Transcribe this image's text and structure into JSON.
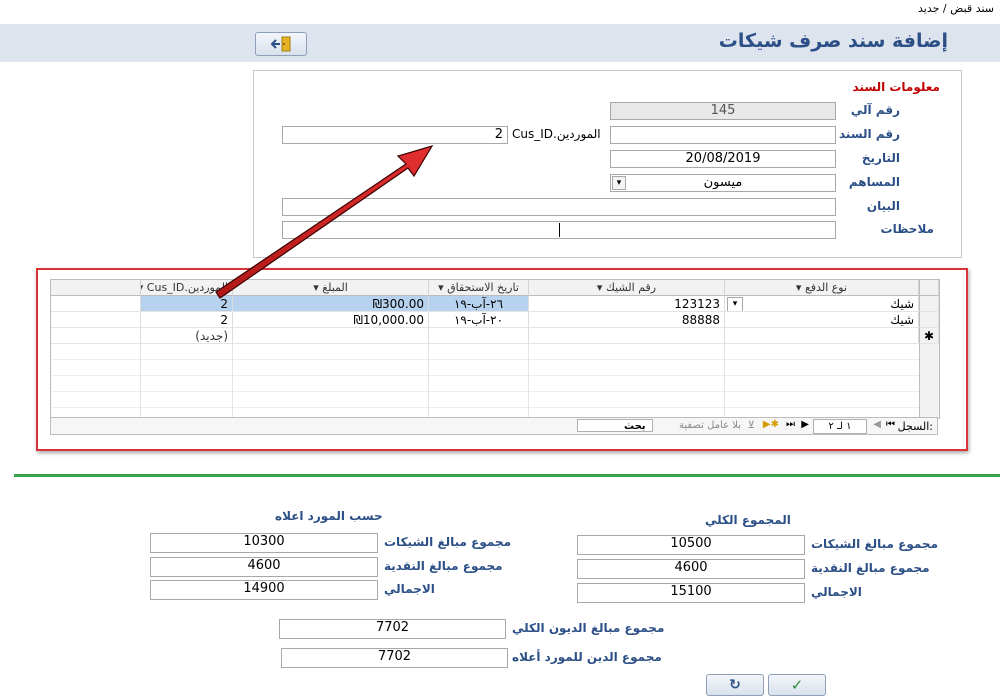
{
  "breadcrumb": "سند قبض / جديد",
  "page_title": "إضافة سند صرف شيكات",
  "section_title": "معلومات السند",
  "labels": {
    "auto_number": "رقم آلي",
    "voucher_number": "رقم السند",
    "date": "التاريخ",
    "contributor": "المساهم",
    "statement": "البيان",
    "notes": "ملاحظات",
    "supplier_field": "الموردين.Cus_ID"
  },
  "fields": {
    "auto_number": "145",
    "voucher_number": "",
    "date": "20/08/2019",
    "contributor": "ميسون",
    "statement": "",
    "notes": "",
    "supplier_value": "2"
  },
  "grid": {
    "columns": [
      "نوع الدفع",
      "رقم الشيك",
      "تاريخ الاستحقاق",
      "المبلغ",
      "الموردين.Cus_ID"
    ],
    "rows": [
      {
        "type": "شيك",
        "check_no": "123123",
        "due": "٢٦-آب-١٩",
        "amount": "₪300.00",
        "supplier": "2"
      },
      {
        "type": "شيك",
        "check_no": "88888",
        "due": "٢٠-آب-١٩",
        "amount": "₪10,000.00",
        "supplier": "2"
      }
    ],
    "new_row": "(جديد)"
  },
  "navigator": {
    "label": "السجل:",
    "position": "١ لـ ٢",
    "no_filter": "بلا عامل تصفية",
    "search": "بحث"
  },
  "summary_total": {
    "title": "المجموع الكلي",
    "checks_label": "مجموع مبالغ الشيكات",
    "checks_value": "10500",
    "cash_label": "مجموع مبالغ النقدية",
    "cash_value": "4600",
    "total_label": "الاجمالي",
    "total_value": "15100"
  },
  "summary_supplier": {
    "title": "حسب المورد اعلاه",
    "checks_label": "مجموع مبالغ الشيكات",
    "checks_value": "10300",
    "cash_label": "مجموع مبالغ النقدية",
    "cash_value": "4600",
    "total_label": "الاجمالي",
    "total_value": "14900"
  },
  "debts": {
    "total_label": "مجموع مبالغ الديون الكلي",
    "total_value": "7702",
    "supplier_label": "مجموع الدين للمورد أعلاه",
    "supplier_value": "7702"
  },
  "colors": {
    "title_blue": "#2b4f86",
    "section_red": "#c00000",
    "highlight_red": "#d9343a",
    "divider_green": "#3aa14a",
    "selected_row": "#b7d2ee"
  }
}
